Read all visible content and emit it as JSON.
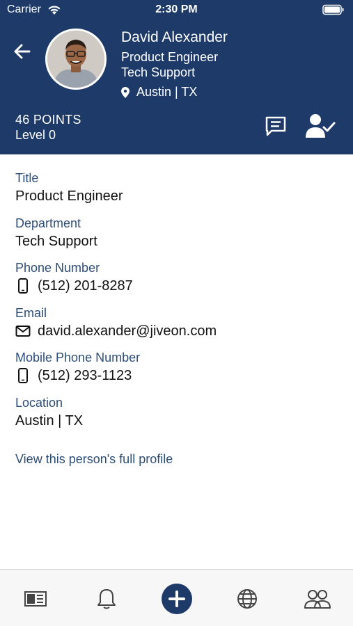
{
  "status_bar": {
    "carrier": "Carrier",
    "time": "2:30 PM",
    "wifi_icon": "wifi-icon",
    "battery_icon": "battery-icon"
  },
  "profile": {
    "name": "David Alexander",
    "title": "Product Engineer",
    "department": "Tech Support",
    "location": "Austin | TX",
    "points": "46 POINTS",
    "level": "Level 0"
  },
  "header_actions": {
    "back_icon": "arrow-left-icon",
    "message_icon": "chat-message-icon",
    "follow_icon": "user-check-icon"
  },
  "details": {
    "title_label": "Title",
    "title_value": "Product Engineer",
    "department_label": "Department",
    "department_value": "Tech Support",
    "phone_label": "Phone Number",
    "phone_value": "(512) 201-8287",
    "email_label": "Email",
    "email_value": "david.alexander@jiveon.com",
    "mobile_label": "Mobile Phone Number",
    "mobile_value": "(512) 293-1123",
    "location_label": "Location",
    "location_value": "Austin | TX"
  },
  "full_profile_link": "View this person's full profile",
  "tabbar": {
    "items": [
      {
        "icon": "news-icon"
      },
      {
        "icon": "bell-icon"
      },
      {
        "icon": "plus-icon"
      },
      {
        "icon": "globe-icon"
      },
      {
        "icon": "people-icon"
      }
    ]
  },
  "colors": {
    "header_bg": "#1d3a68",
    "label": "#2d4d79",
    "tab_icon": "#444444"
  }
}
